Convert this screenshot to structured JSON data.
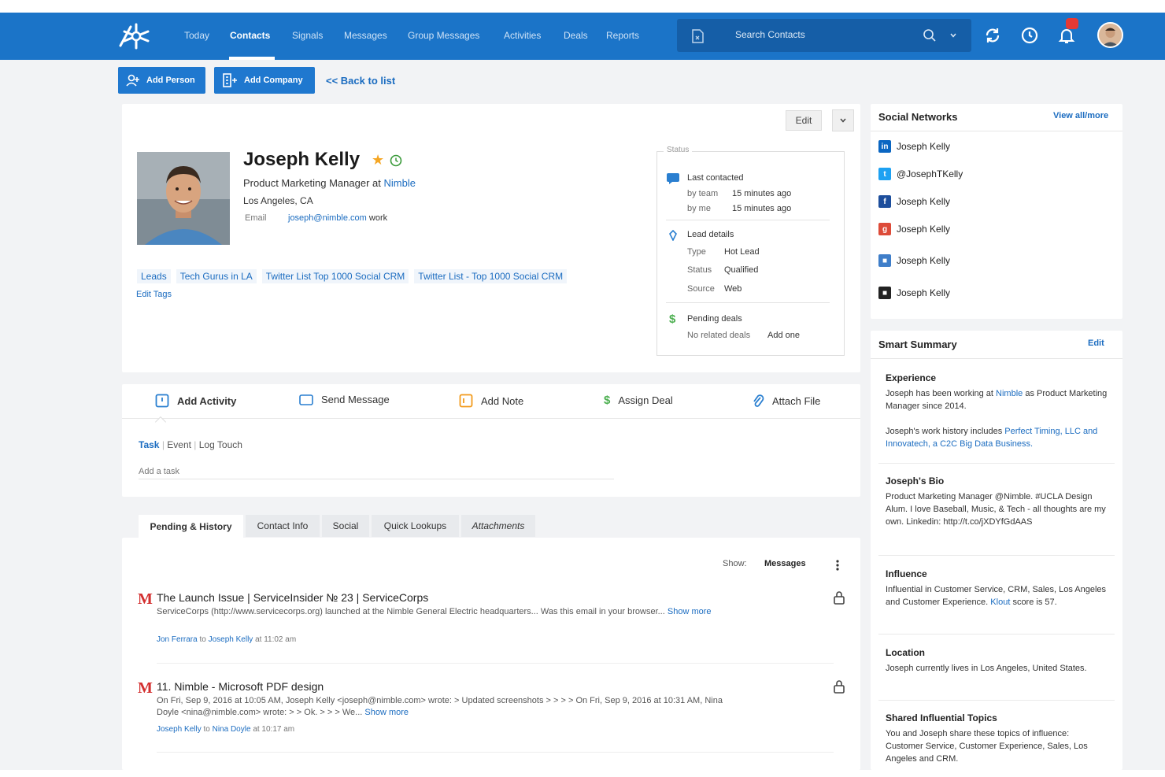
{
  "nav": {
    "items": [
      "Today",
      "Contacts",
      "Signals",
      "Messages",
      "Group Messages",
      "Activities",
      "Deals",
      "Reports"
    ],
    "active": "Contacts",
    "search_placeholder": "Search Contacts"
  },
  "actions": {
    "add_person": "Add Person",
    "add_company": "Add Company",
    "back": "<< Back to list"
  },
  "header": {
    "edit": "Edit"
  },
  "contact": {
    "name": "Joseph Kelly",
    "title_prefix": "Product Marketing Manager at",
    "company": "Nimble",
    "location": "Los Angeles, CA",
    "email_label": "Email",
    "email": "joseph@nimble.com",
    "email_type": "work",
    "tags": [
      "Leads",
      "Tech Gurus in LA",
      "Twitter List Top 1000 Social CRM",
      "Twitter List - Top 1000 Social CRM"
    ],
    "edit_tags": "Edit Tags"
  },
  "status": {
    "legend": "Status",
    "last_contacted": "Last contacted",
    "by_team_label": "by team",
    "by_team_value": "15 minutes ago",
    "by_me_label": "by me",
    "by_me_value": "15 minutes ago",
    "lead_details": "Lead details",
    "type_label": "Type",
    "type_value": "Hot Lead",
    "status_label": "Status",
    "status_value": "Qualified",
    "source_label": "Source",
    "source_value": "Web",
    "pending_deals": "Pending deals",
    "no_deals": "No related deals",
    "add_one": "Add one"
  },
  "activity": {
    "items": [
      "Add Activity",
      "Send Message",
      "Add Note",
      "Assign Deal",
      "Attach File"
    ],
    "subtabs": [
      "Task",
      "Event",
      "Log Touch"
    ],
    "placeholder": "Add a task"
  },
  "tabs": [
    "Pending & History",
    "Contact Info",
    "Social",
    "Quick Lookups",
    "Attachments"
  ],
  "history": {
    "show_label": "Show:",
    "show_value": "Messages",
    "messages": [
      {
        "title": "The Launch Issue | ServiceInsider № 23 | ServiceCorps",
        "body": "ServiceCorps (http://www.servicecorps.org) launched at the Nimble General Electric headquarters... Was this email in your browser...",
        "more": "Show more",
        "meta_from": "Jon Ferrara",
        "meta_to": "Joseph Kelly",
        "meta_time": "at 11:02 am"
      },
      {
        "title": "11. Nimble - Microsoft PDF design",
        "body": "On Fri, Sep 9, 2016 at 10:05 AM, Joseph Kelly <joseph@nimble.com> wrote: > Updated screenshots > > > > On Fri, Sep 9, 2016 at 10:31 AM, Nina Doyle <nina@nimble.com> wrote: > > Ok. > > > We...",
        "more": "Show more",
        "meta_from": "Joseph Kelly",
        "meta_to": "Nina Doyle",
        "meta_time": "at 10:17 am"
      }
    ]
  },
  "social": {
    "title": "Social Networks",
    "view_link": "View all/more",
    "items": [
      {
        "network": "linkedin",
        "label": "Joseph Kelly",
        "color": "#0a66c2",
        "glyph": "in"
      },
      {
        "network": "twitter",
        "label": "@JosephTKelly",
        "color": "#1da1f2",
        "glyph": "t"
      },
      {
        "network": "facebook",
        "label": "Joseph Kelly",
        "color": "#1d4e9c",
        "glyph": "f"
      },
      {
        "network": "google-plus",
        "label": "Joseph Kelly",
        "color": "#dd4b39",
        "glyph": "g"
      },
      {
        "network": "foursquare",
        "label": "Joseph Kelly",
        "color": "#3f7ec9",
        "glyph": "■"
      },
      {
        "network": "other",
        "label": "Joseph Kelly",
        "color": "#222222",
        "glyph": "■"
      }
    ]
  },
  "summary": {
    "title": "Smart Summary",
    "edit": "Edit",
    "experience_h": "Experience",
    "experience_p1_a": "Joseph has been working at",
    "experience_p1_link": "Nimble",
    "experience_p1_b": "as Product Marketing Manager since 2014.",
    "experience_p2_a": "Joseph's work history includes",
    "experience_p2_link": "Perfect Timing, LLC and Innovatech, a C2C Big Data Business.",
    "bio_h": "Joseph's Bio",
    "bio_p": "Product Marketing Manager @Nimble. #UCLA Design Alum. I love Baseball, Music, & Tech - all thoughts are my own. Linkedin: http://t.co/jXDYfGdAAS",
    "influence_h": "Influence",
    "influence_p": "Influential in Customer Service, CRM, Sales, Los Angeles and Customer Experience.",
    "influence_link": "Klout",
    "influence_score": "score is 57.",
    "location_h": "Location",
    "location_p": "Joseph currently lives in Los Angeles, United States.",
    "topics_h": "Shared Influential Topics",
    "topics_p": "You and Joseph share these topics of influence: Customer Service, Customer Experience, Sales, Los Angeles and CRM."
  }
}
